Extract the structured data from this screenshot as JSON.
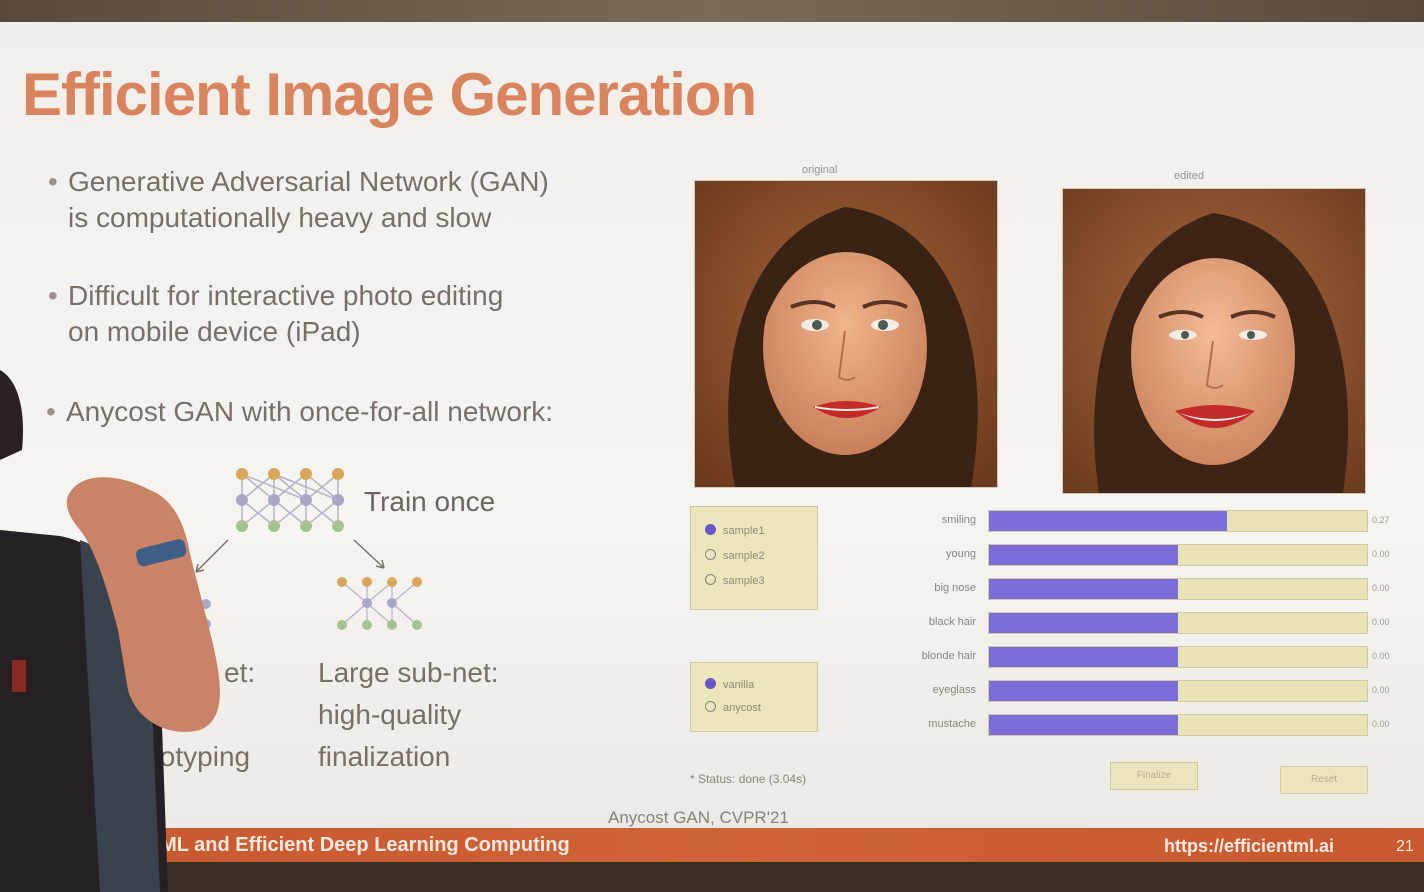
{
  "slide": {
    "title": "Efficient Image Generation",
    "bullets": [
      [
        "Generative Adversarial Network (GAN)",
        "is computationally heavy and slow"
      ],
      [
        "Difficult for interactive photo editing",
        "on mobile device (iPad)"
      ],
      [
        "Anycost GAN with once-for-all network:"
      ]
    ],
    "network": {
      "train_once": "Train once",
      "small_caption": [
        "et:",
        "t prototyping"
      ],
      "large_caption": [
        "Large sub-net:",
        "high-quality",
        "finalization"
      ]
    },
    "demo": {
      "original_label": "original",
      "edited_label": "edited",
      "samples": [
        {
          "label": "sample1",
          "selected": true
        },
        {
          "label": "sample2",
          "selected": false
        },
        {
          "label": "sample3",
          "selected": false
        }
      ],
      "modes": [
        {
          "label": "vanilla",
          "selected": true
        },
        {
          "label": "anycost",
          "selected": false
        }
      ],
      "attributes": [
        {
          "label": "smiling",
          "value": 0.63,
          "readout": "0.27"
        },
        {
          "label": "young",
          "value": 0.5,
          "readout": "0.00"
        },
        {
          "label": "big nose",
          "value": 0.5,
          "readout": "0.00"
        },
        {
          "label": "black hair",
          "value": 0.5,
          "readout": "0.00"
        },
        {
          "label": "blonde hair",
          "value": 0.5,
          "readout": "0.00"
        },
        {
          "label": "eyeglass",
          "value": 0.5,
          "readout": "0.00"
        },
        {
          "label": "mustache",
          "value": 0.5,
          "readout": "0.00"
        }
      ],
      "status": "* Status: done (3.04s)",
      "finalize_label": "Finalize",
      "reset_label": "Reset"
    },
    "citation": "Anycost GAN, CVPR'21",
    "footer": {
      "course": "0: TinyML and Efficient Deep Learning Computing",
      "url": "https://efficientml.ai",
      "page": "21"
    },
    "colors": {
      "title": "#d9845c",
      "footer": "#cc5e33",
      "slider_fill": "#7b6ddc",
      "slider_track": "#e9e3b8"
    }
  }
}
